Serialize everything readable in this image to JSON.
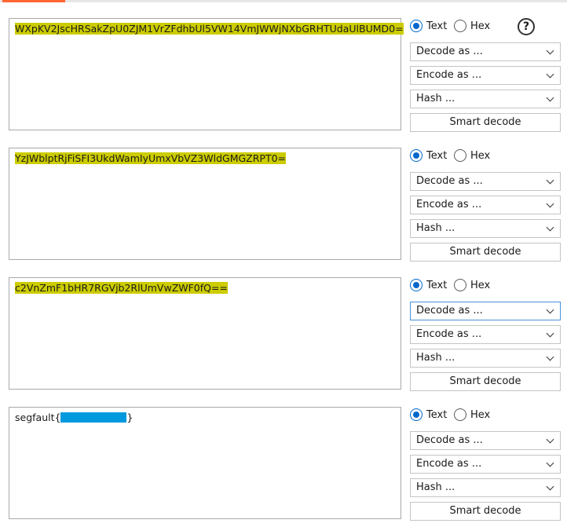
{
  "panels": [
    {
      "content": "WXpKV2JscHRSakZpU0ZJM1VrZFdhbUl5VW14VmJWWjNXbGRHTUdaUlBUMD0=",
      "highlighted": true,
      "redacted": false,
      "format": {
        "text_label": "Text",
        "hex_label": "Hex",
        "selected": "Text"
      },
      "decode_label": "Decode as ...",
      "encode_label": "Encode as ...",
      "hash_label": "Hash ...",
      "smart_label": "Smart decode",
      "help_symbol": "?"
    },
    {
      "content": "YzJWblptRjFiSFI3UkdWamIyUmxVbVZ3WldGMGZRPT0=",
      "highlighted": true,
      "redacted": false,
      "format": {
        "text_label": "Text",
        "hex_label": "Hex",
        "selected": "Text"
      },
      "decode_label": "Decode as ...",
      "encode_label": "Encode as ...",
      "hash_label": "Hash ...",
      "smart_label": "Smart decode"
    },
    {
      "content": "c2VnZmF1bHR7RGVjb2RlUmVwZWF0fQ==",
      "highlighted": true,
      "redacted": false,
      "format": {
        "text_label": "Text",
        "hex_label": "Hex",
        "selected": "Text"
      },
      "decode_label": "Decode as ...",
      "encode_label": "Encode as ...",
      "hash_label": "Hash ...",
      "smart_label": "Smart decode"
    },
    {
      "content_prefix": "segfault{",
      "content_suffix": "}",
      "highlighted": false,
      "redacted": true,
      "format": {
        "text_label": "Text",
        "hex_label": "Hex",
        "selected": "Text"
      },
      "decode_label": "Decode as ...",
      "encode_label": "Encode as ...",
      "hash_label": "Hash ...",
      "smart_label": "Smart decode"
    }
  ],
  "colors": {
    "highlight": "#cccc00",
    "redaction": "#0099dd",
    "accent": "#ff6633",
    "radio_selected": "#0066cc",
    "focus_border": "#4a90d9"
  }
}
